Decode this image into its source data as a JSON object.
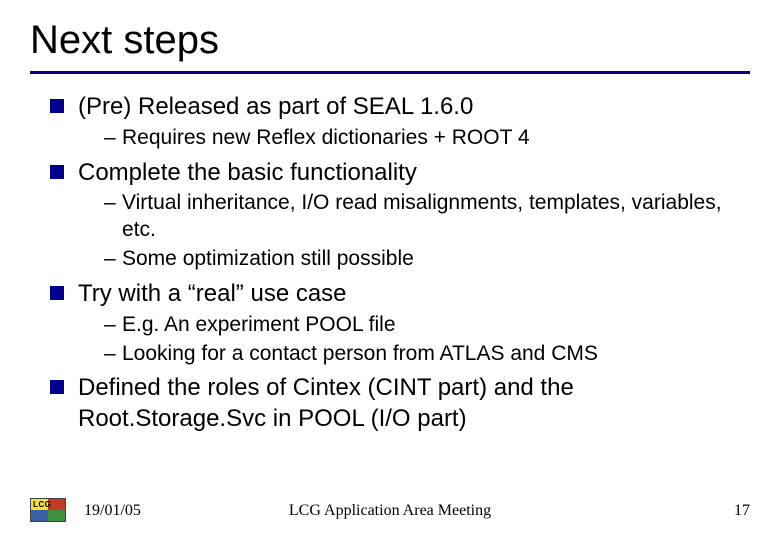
{
  "title": "Next steps",
  "bullets": {
    "b0": {
      "text": "(Pre) Released as part of SEAL 1.6.0"
    },
    "s0_0": "Requires new Reflex dictionaries + ROOT 4",
    "b1": {
      "text": "Complete the basic functionality"
    },
    "s1_0": "Virtual inheritance, I/O read misalignments, templates, variables, etc.",
    "s1_1": "Some optimization still possible",
    "b2": {
      "text": "Try with a “real” use case"
    },
    "s2_0": "E.g. An experiment POOL file",
    "s2_1": "Looking for a contact person from ATLAS and CMS",
    "b3": {
      "text": "Defined the roles of Cintex (CINT part) and the Root.Storage.Svc in POOL (I/O part)"
    }
  },
  "footer": {
    "logo_text": "LCG",
    "date": "19/01/05",
    "center": "LCG Application Area Meeting",
    "page": "17"
  }
}
